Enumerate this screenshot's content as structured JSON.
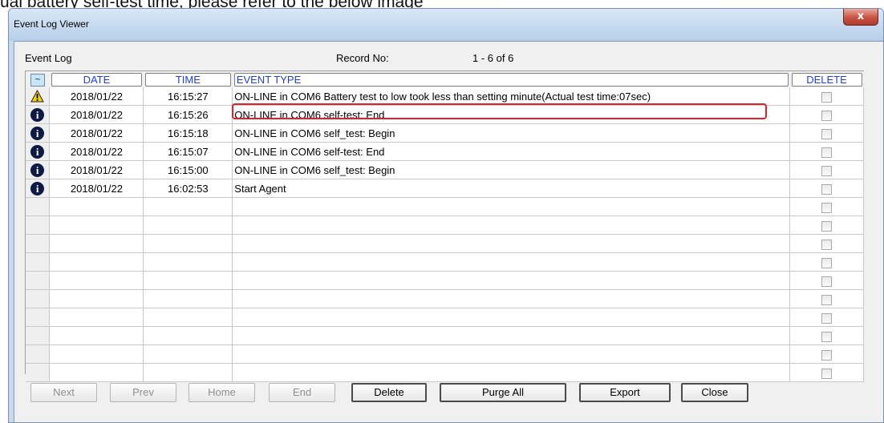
{
  "background_caption": "ual battery self-test time, please refer to the below image",
  "window": {
    "title": "Event Log Viewer",
    "close_label": "x"
  },
  "header": {
    "event_log_label": "Event Log",
    "record_no_label": "Record No:",
    "record_range": "1 - 6 of 6"
  },
  "columns": {
    "sort": "~",
    "date": "DATE",
    "time": "TIME",
    "event_type": "EVENT TYPE",
    "delete": "DELETE"
  },
  "rows": [
    {
      "icon": "warning-icon",
      "date": "2018/01/22",
      "time": "16:15:27",
      "event": "ON-LINE in COM6 Battery test to low took less than setting minute(Actual test time:07sec)"
    },
    {
      "icon": "info-icon",
      "date": "2018/01/22",
      "time": "16:15:26",
      "event": "ON-LINE in COM6 self-test: End"
    },
    {
      "icon": "info-icon",
      "date": "2018/01/22",
      "time": "16:15:18",
      "event": "ON-LINE in COM6 self_test: Begin"
    },
    {
      "icon": "info-icon",
      "date": "2018/01/22",
      "time": "16:15:07",
      "event": "ON-LINE in COM6 self-test: End"
    },
    {
      "icon": "info-icon",
      "date": "2018/01/22",
      "time": "16:15:00",
      "event": "ON-LINE in COM6 self_test: Begin"
    },
    {
      "icon": "info-icon",
      "date": "2018/01/22",
      "time": "16:02:53",
      "event": "Start Agent"
    },
    {
      "icon": "",
      "date": "",
      "time": "",
      "event": ""
    },
    {
      "icon": "",
      "date": "",
      "time": "",
      "event": ""
    },
    {
      "icon": "",
      "date": "",
      "time": "",
      "event": ""
    },
    {
      "icon": "",
      "date": "",
      "time": "",
      "event": ""
    },
    {
      "icon": "",
      "date": "",
      "time": "",
      "event": ""
    },
    {
      "icon": "",
      "date": "",
      "time": "",
      "event": ""
    },
    {
      "icon": "",
      "date": "",
      "time": "",
      "event": ""
    },
    {
      "icon": "",
      "date": "",
      "time": "",
      "event": ""
    },
    {
      "icon": "",
      "date": "",
      "time": "",
      "event": ""
    },
    {
      "icon": "",
      "date": "",
      "time": "",
      "event": ""
    }
  ],
  "buttons": [
    {
      "label": "Next",
      "enabled": false
    },
    {
      "label": "Prev",
      "enabled": false
    },
    {
      "label": "Home",
      "enabled": false
    },
    {
      "label": "End",
      "enabled": false
    },
    {
      "label": "Delete",
      "enabled": true
    },
    {
      "label": "Purge All",
      "enabled": true
    },
    {
      "label": "Export",
      "enabled": true
    },
    {
      "label": "Close",
      "enabled": true
    }
  ],
  "colors": {
    "highlight": "#e0202a",
    "header_text": "#1f3fd8",
    "warning": "#f5d400",
    "info": "#0c1a44"
  }
}
